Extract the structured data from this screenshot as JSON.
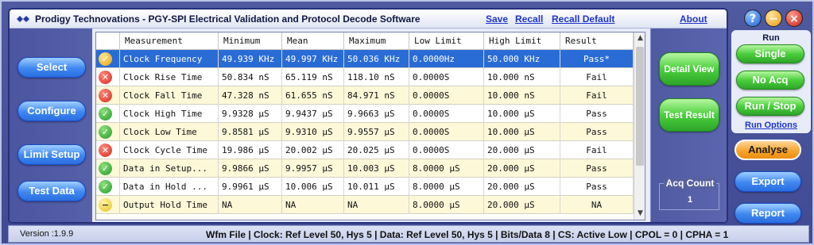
{
  "app": {
    "title": "Prodigy Technovations - PGY-SPI Electrical Validation and Protocol Decode Software",
    "links": {
      "save": "Save",
      "recall": "Recall",
      "recall_default": "Recall Default",
      "about": "About"
    }
  },
  "left_nav": {
    "select": "Select",
    "configure": "Configure",
    "limit_setup": "Limit Setup",
    "test_data": "Test Data"
  },
  "table": {
    "columns": [
      "Measurement",
      "Minimum",
      "Mean",
      "Maximum",
      "Low Limit",
      "High Limit",
      "Result"
    ],
    "rows": [
      {
        "status": "warn",
        "measurement": "Clock Frequency",
        "minimum": "49.939 KHz",
        "mean": "49.997 KHz",
        "maximum": "50.036 KHz",
        "low_limit": "0.0000Hz",
        "high_limit": "50.000 KHz",
        "result": "Pass*"
      },
      {
        "status": "fail",
        "measurement": "Clock Rise Time",
        "minimum": "50.834 nS",
        "mean": "65.119 nS",
        "maximum": "118.10 nS",
        "low_limit": "0.0000S",
        "high_limit": "10.000 nS",
        "result": "Fail"
      },
      {
        "status": "fail",
        "measurement": "Clock Fall Time",
        "minimum": "47.328 nS",
        "mean": "61.655 nS",
        "maximum": "84.971 nS",
        "low_limit": "0.0000S",
        "high_limit": "10.000 nS",
        "result": "Fail"
      },
      {
        "status": "pass",
        "measurement": "Clock High Time",
        "minimum": "9.9328 µS",
        "mean": "9.9437 µS",
        "maximum": "9.9663 µS",
        "low_limit": "0.0000S",
        "high_limit": "10.000 µS",
        "result": "Pass"
      },
      {
        "status": "pass",
        "measurement": "Clock Low Time",
        "minimum": "9.8581 µS",
        "mean": "9.9310 µS",
        "maximum": "9.9557 µS",
        "low_limit": "0.0000S",
        "high_limit": "10.000 µS",
        "result": "Pass"
      },
      {
        "status": "fail",
        "measurement": "Clock Cycle Time",
        "minimum": "19.986 µS",
        "mean": "20.002 µS",
        "maximum": "20.025 µS",
        "low_limit": "0.0000S",
        "high_limit": "20.000 µS",
        "result": "Fail"
      },
      {
        "status": "pass",
        "measurement": "Data in Setup...",
        "minimum": "9.9866 µS",
        "mean": "9.9957 µS",
        "maximum": "10.003 µS",
        "low_limit": "8.0000 µS",
        "high_limit": "20.000 µS",
        "result": "Pass"
      },
      {
        "status": "pass",
        "measurement": "Data in Hold ...",
        "minimum": "9.9961 µS",
        "mean": "10.006 µS",
        "maximum": "10.011 µS",
        "low_limit": "8.0000 µS",
        "high_limit": "20.000 µS",
        "result": "Pass"
      },
      {
        "status": "na",
        "measurement": "Output Hold Time",
        "minimum": "NA",
        "mean": "NA",
        "maximum": "NA",
        "low_limit": "8.0000 µS",
        "high_limit": "20.000 µS",
        "result": "NA"
      }
    ]
  },
  "right_actions": {
    "detail_view": "Detail View",
    "test_result": "Test Result",
    "acq_count_label": "Acq Count",
    "acq_count_value": "1"
  },
  "run_panel": {
    "label": "Run",
    "single": "Single",
    "no_acq": "No Acq",
    "run_stop": "Run / Stop",
    "run_options": "Run Options"
  },
  "side_actions": {
    "analyse": "Analyse",
    "export": "Export",
    "report": "Report"
  },
  "window_controls": {
    "help": "?",
    "minimize": "−",
    "close": "×"
  },
  "status_bar": {
    "version": "Version :1.9.9",
    "text": "Wfm File  | Clock: Ref Level 50, Hys 5 | Data: Ref Level 50, Hys 5 | Bits/Data 8 | CS: Active Low  | CPOL = 0  | CPHA = 1"
  },
  "icons": {
    "pass": "check-icon",
    "fail": "x-icon",
    "warn": "check-warning-icon",
    "na": "minus-icon"
  },
  "colors": {
    "pass": "#1f9b2a",
    "fail": "#d62a1e",
    "warn": "#e9a10e",
    "selection": "#2a6cd6",
    "link": "#1f35c8"
  }
}
